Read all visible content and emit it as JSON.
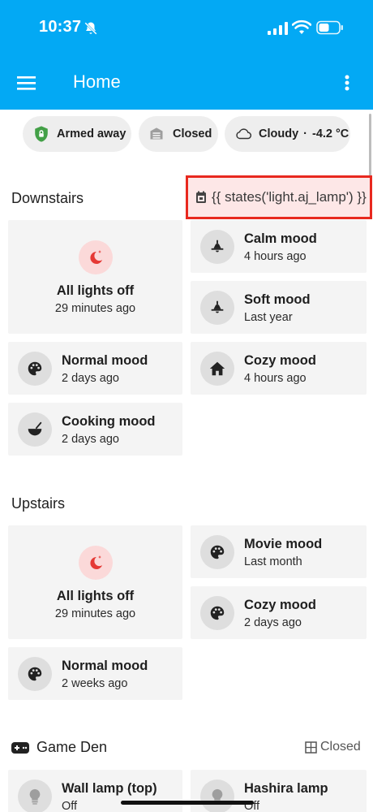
{
  "status_bar": {
    "time": "10:37"
  },
  "header": {
    "title": "Home"
  },
  "badges": {
    "armed": "Armed away",
    "garage": "Closed",
    "weather_condition": "Cloudy",
    "weather_separator": "·",
    "weather_temp": "-4.2 °C"
  },
  "downstairs": {
    "title": "Downstairs",
    "template_text": "{{ states('light.aj_lamp') }}",
    "all_lights": {
      "name": "All lights off",
      "time": "29 minutes ago"
    },
    "calm": {
      "name": "Calm mood",
      "time": "4 hours ago"
    },
    "soft": {
      "name": "Soft mood",
      "time": "Last year"
    },
    "normal": {
      "name": "Normal mood",
      "time": "2 days ago"
    },
    "cozy": {
      "name": "Cozy mood",
      "time": "4 hours ago"
    },
    "cooking": {
      "name": "Cooking mood",
      "time": "2 days ago"
    }
  },
  "upstairs": {
    "title": "Upstairs",
    "all_lights": {
      "name": "All lights off",
      "time": "29 minutes ago"
    },
    "movie": {
      "name": "Movie mood",
      "time": "Last month"
    },
    "cozy": {
      "name": "Cozy mood",
      "time": "2 days ago"
    },
    "normal": {
      "name": "Normal mood",
      "time": "2 weeks ago"
    }
  },
  "game_den": {
    "title": "Game Den",
    "door_state": "Closed",
    "wall_lamp": {
      "name": "Wall lamp (top)",
      "state": "Off"
    },
    "hashira": {
      "name": "Hashira lamp",
      "state": "Off"
    }
  },
  "colors": {
    "header": "#03a9f4",
    "card": "#f4f4f4",
    "highlight_border": "#e8281e",
    "night_icon": "#e53935"
  }
}
